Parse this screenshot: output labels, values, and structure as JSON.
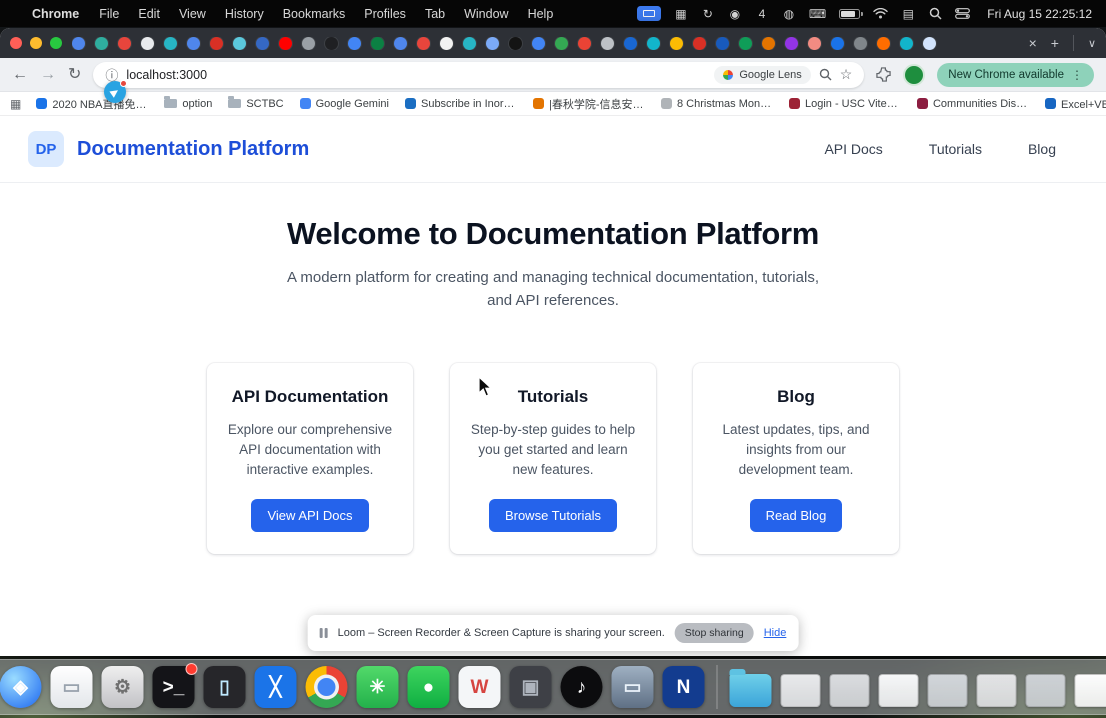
{
  "menubar": {
    "apple": "",
    "app_name": "Chrome",
    "items": [
      "File",
      "Edit",
      "View",
      "History",
      "Bookmarks",
      "Profiles",
      "Tab",
      "Window",
      "Help"
    ],
    "status_icons": [
      {
        "name": "screen-sharing-indicator",
        "type": "pill"
      },
      {
        "name": "window-grid",
        "glyph": "▦"
      },
      {
        "name": "sync",
        "glyph": "↻"
      },
      {
        "name": "dropbox",
        "glyph": "◉"
      },
      {
        "name": "mouse-battery-count",
        "glyph": "4"
      },
      {
        "name": "globe",
        "glyph": "◍"
      },
      {
        "name": "keyboard-input",
        "glyph": "⌨"
      },
      {
        "name": "battery",
        "type": "battery"
      },
      {
        "name": "wifi",
        "type": "wifi"
      },
      {
        "name": "menu-list",
        "glyph": "▤"
      },
      {
        "name": "spotlight-search",
        "type": "search"
      },
      {
        "name": "control-center",
        "type": "cc"
      }
    ],
    "clock": "Fri Aug 15 22:25:12"
  },
  "browser": {
    "tab_favicons": [
      "#4f86ec",
      "#2fae9f",
      "#e8453c",
      "#e8eaed",
      "#27b5c4",
      "#4f86ec",
      "#d93025",
      "#5bc8dc",
      "#3568c4",
      "#ff0000",
      "#9aa0a6",
      "#1f2023",
      "#4285f4",
      "#0b8043",
      "#4f86ec",
      "#e8453c",
      "#f2f2f2",
      "#27b5c4",
      "#7baaf7",
      "#141414",
      "#4285f4",
      "#34a853",
      "#ea4335",
      "#bdc1c6",
      "#1967d2",
      "#12b5cb",
      "#fbbc04",
      "#d93025",
      "#185abc",
      "#0f9d58",
      "#e37400",
      "#9334e6",
      "#f28b82",
      "#1a73e8",
      "#80868b",
      "#ff6d00",
      "#12b5cb",
      "#d2e3fc"
    ],
    "tab_close": "×",
    "new_tab": "+",
    "tab_menu": "∨",
    "icons": {
      "back": "←",
      "forward": "→",
      "reload": "↻",
      "site_info": "ⓘ",
      "bookmark_star": "☆",
      "more": "⋮",
      "apps_grid": "▦"
    },
    "url": "localhost:3000",
    "lens_label": "Google Lens",
    "update_button": "New Chrome available",
    "update_pill_color": "#8ed2ba",
    "bookmarks": [
      {
        "label": "2020 NBA直播免費...",
        "icon": "#1a73e8"
      },
      {
        "label": "option",
        "icon": "folder"
      },
      {
        "label": "SCTBC",
        "icon": "folder"
      },
      {
        "label": "Google Gemini",
        "icon": "#4285f4"
      },
      {
        "label": "Subscribe in Inore...",
        "icon": "#1b6ec2"
      },
      {
        "label": "|春秋学院-信息安全...",
        "icon": "#e37400"
      },
      {
        "label": "8 Christmas Mons...",
        "icon": "#b0b4b8"
      },
      {
        "label": "Login - USC Viterb...",
        "icon": "#9d2235"
      },
      {
        "label": "Communities Disc...",
        "icon": "#8c1d40"
      },
      {
        "label": "Excel+VBA制作小...",
        "icon": "#1766c2"
      }
    ],
    "bookmarks_overflow": "»"
  },
  "page": {
    "accent_color": "#2563eb",
    "logo_text": "DP",
    "site_title": "Documentation Platform",
    "nav": [
      {
        "label": "API Docs"
      },
      {
        "label": "Tutorials"
      },
      {
        "label": "Blog"
      }
    ],
    "hero_title": "Welcome to Documentation Platform",
    "hero_subtitle": "A modern platform for creating and managing technical documentation, tutorials, and API references.",
    "cards": [
      {
        "title": "API Documentation",
        "description": "Explore our comprehensive API documentation with interactive examples.",
        "button": "View API Docs"
      },
      {
        "title": "Tutorials",
        "description": "Step-by-step guides to help you get started and learn new features.",
        "button": "Browse Tutorials"
      },
      {
        "title": "Blog",
        "description": "Latest updates, tips, and insights from our development team.",
        "button": "Read Blog"
      }
    ]
  },
  "loom": {
    "message": "Loom – Screen Recorder & Screen Capture is sharing your screen.",
    "stop_button": "Stop sharing",
    "hide_link": "Hide"
  },
  "dock": {
    "apps": [
      {
        "name": "finder",
        "bg": "linear-gradient(180deg,#7cc9f4,#1c6fdd)",
        "glyph": "☺",
        "fg": "#ffffff"
      },
      {
        "name": "launchpad",
        "bg": "radial-gradient(circle at 50% 45%,#7a7a80,#2a2a2d)",
        "glyph": "▦",
        "fg": "#e6e6e6"
      },
      {
        "name": "safari",
        "bg": "radial-gradient(circle at 35% 30%,#9adcff,#1b66f0)",
        "glyph": "◈",
        "fg": "#ffffff",
        "shape": "circle"
      },
      {
        "name": "files",
        "bg": "linear-gradient(#ffffff,#e3e6ea)",
        "glyph": "▭",
        "fg": "#98a2ad"
      },
      {
        "name": "settings",
        "bg": "linear-gradient(#efefef,#c2c2c6)",
        "glyph": "⚙",
        "fg": "#707070"
      },
      {
        "name": "terminal",
        "bg": "#141418",
        "glyph": ">_",
        "fg": "#fafafa",
        "badge": true
      },
      {
        "name": "iphone-mirroring",
        "bg": "#26262a",
        "glyph": "▯",
        "fg": "#bfe9ff"
      },
      {
        "name": "code-editor",
        "bg": "#1b74e8",
        "glyph": "╳",
        "fg": "#ffffff"
      },
      {
        "name": "chrome",
        "type": "chrome"
      },
      {
        "name": "green-app",
        "bg": "linear-gradient(#52d96a,#23b14b)",
        "glyph": "✳",
        "fg": "#ffffff"
      },
      {
        "name": "wechat",
        "bg": "linear-gradient(#3ed45e,#0faf42)",
        "glyph": "●",
        "fg": "#ffffff"
      },
      {
        "name": "word",
        "bg": "#f4f6f8",
        "glyph": "W",
        "fg": "#d64541"
      },
      {
        "name": "dark-app",
        "bg": "#3e4046",
        "glyph": "▣",
        "fg": "#aeb4bd"
      },
      {
        "name": "music",
        "bg": "#0c0c0e",
        "glyph": "♪",
        "fg": "#ffffff",
        "shape": "circle"
      },
      {
        "name": "display-app",
        "bg": "linear-gradient(#9fb0c2,#5f7085)",
        "glyph": "▭",
        "fg": "#eaf2fa"
      },
      {
        "name": "blue-n-app",
        "bg": "#133c8f",
        "glyph": "N",
        "fg": "#ffffff"
      }
    ],
    "minimized_windows": [
      "#e9eaec",
      "#dadcdf",
      "#f6f7f8",
      "#d2d6da",
      "#e3e4e6",
      "#ced2d6",
      "#fdfdfd",
      "#dfe1e3"
    ]
  }
}
